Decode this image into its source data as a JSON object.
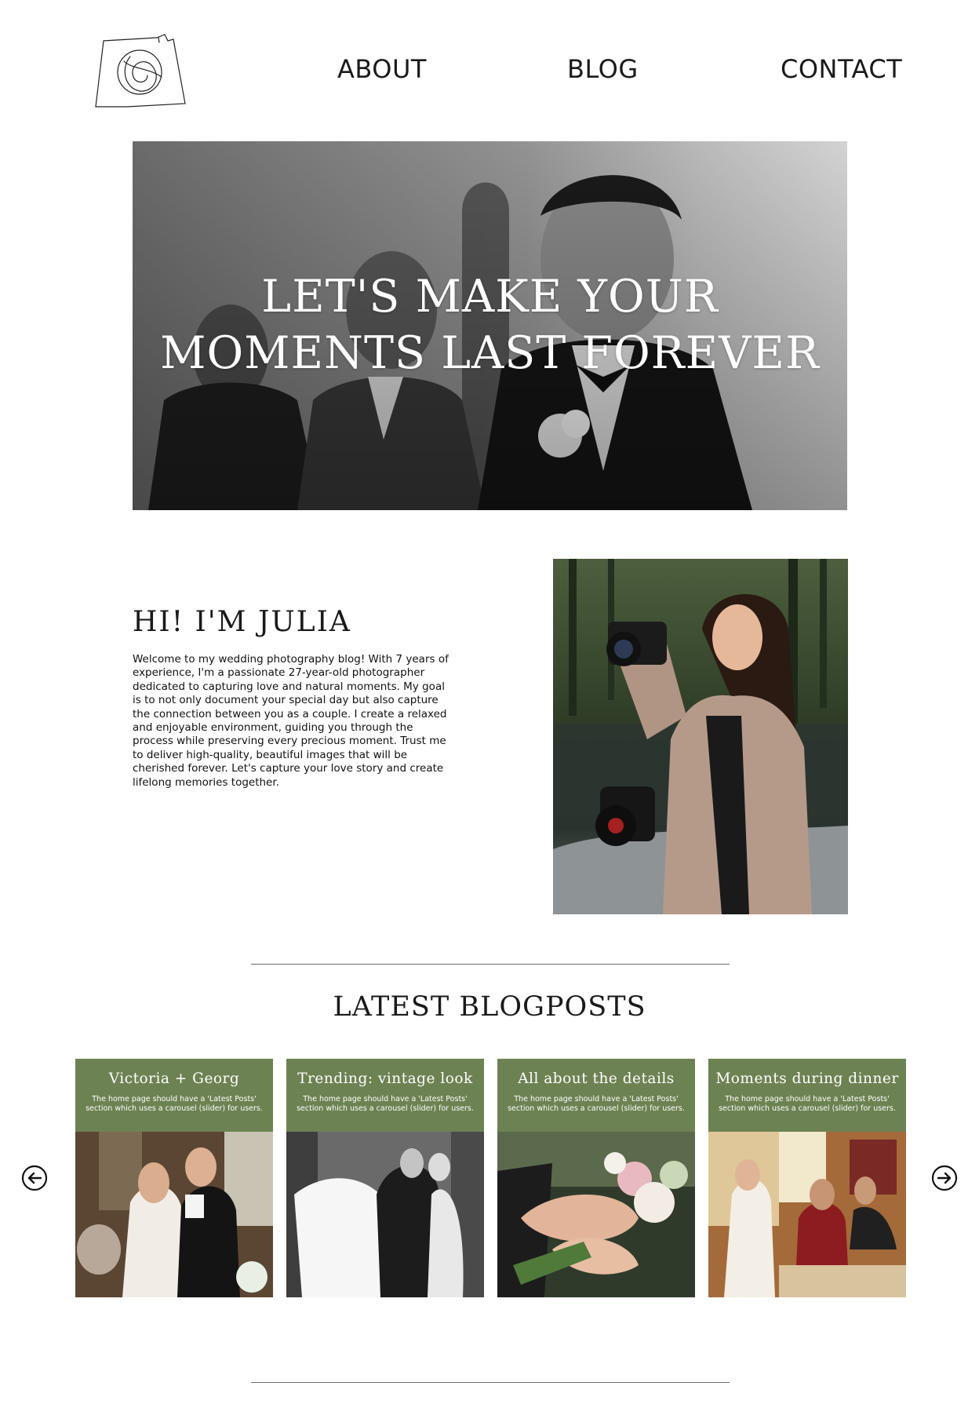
{
  "nav": {
    "logo_icon": "camera-sketch-logo",
    "items": [
      {
        "label": "ABOUT"
      },
      {
        "label": "BLOG"
      },
      {
        "label": "CONTACT"
      }
    ]
  },
  "hero": {
    "title": "LET'S MAKE YOUR MOMENTS LAST FOREVER"
  },
  "about": {
    "heading": "HI! I'M JULIA",
    "body": "Welcome to my wedding photography blog! With 7 years of experience, I'm a passionate 27-year-old photographer dedicated to capturing love and natural moments. My goal is to not only document your special day but also capture the connection between you as a couple. I create a relaxed and enjoyable environment, guiding you through the process while preserving every precious moment. Trust me to deliver high-quality, beautiful images that will be cherished forever. Let's capture your love story and create lifelong memories together."
  },
  "blog": {
    "heading": "LATEST BLOGPOSTS",
    "prev_icon": "arrow-left-circle-icon",
    "next_icon": "arrow-right-circle-icon",
    "posts": [
      {
        "title": "Victoria + Georg",
        "description": "The home page should have a 'Latest Posts' section which uses a carousel (slider) for users."
      },
      {
        "title": "Trending: vintage look",
        "description": "The home page should have a 'Latest Posts' section which uses a carousel (slider) for users."
      },
      {
        "title": "All about the details",
        "description": "The home page should have a 'Latest Posts' section which uses a carousel (slider) for users."
      },
      {
        "title": "Moments during dinner",
        "description": "The home page should have a 'Latest Posts' section which uses a carousel (slider) for users."
      }
    ]
  },
  "colors": {
    "accent": "#6d8252",
    "text": "#1a1a1a",
    "background": "#ffffff"
  }
}
